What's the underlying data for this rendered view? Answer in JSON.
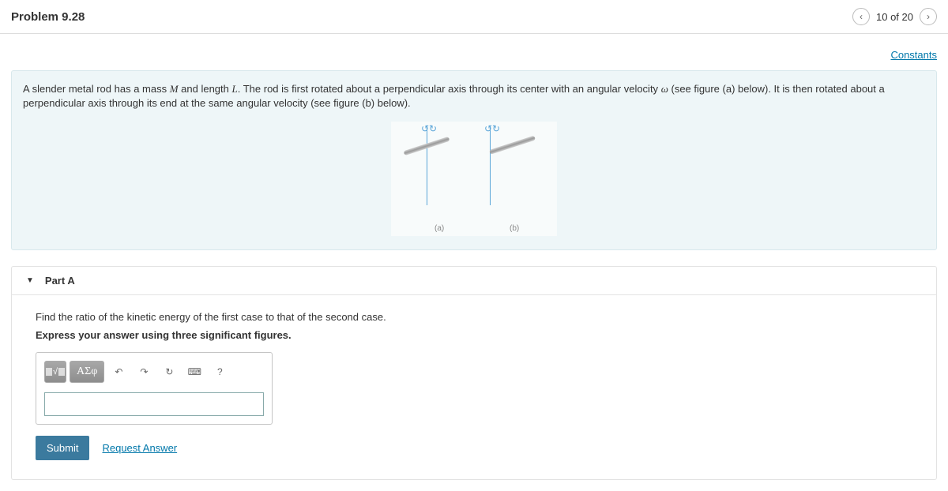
{
  "header": {
    "title": "Problem 9.28",
    "nav_count": "10 of 20"
  },
  "links": {
    "constants": "Constants",
    "request_answer": "Request Answer"
  },
  "problem": {
    "t1": "A slender metal rod has a mass ",
    "v1": "M",
    "t2": " and length ",
    "v2": "L",
    "t3": ". The rod is first rotated about a perpendicular axis through its center with an angular velocity ",
    "v3": "ω",
    "t4": " (see figure (a) below). It is then rotated about a perpendicular axis through its end at the same angular velocity (see figure (b) below).",
    "fig_a": "(a)",
    "fig_b": "(b)"
  },
  "part": {
    "label": "Part A",
    "instr1": "Find the ratio of the kinetic energy of the first case to that of the second case.",
    "instr2": "Express your answer using three significant figures.",
    "toolbar": {
      "templates": "x√",
      "greek": "ΑΣφ",
      "help": "?"
    },
    "submit": "Submit",
    "answer_value": ""
  }
}
